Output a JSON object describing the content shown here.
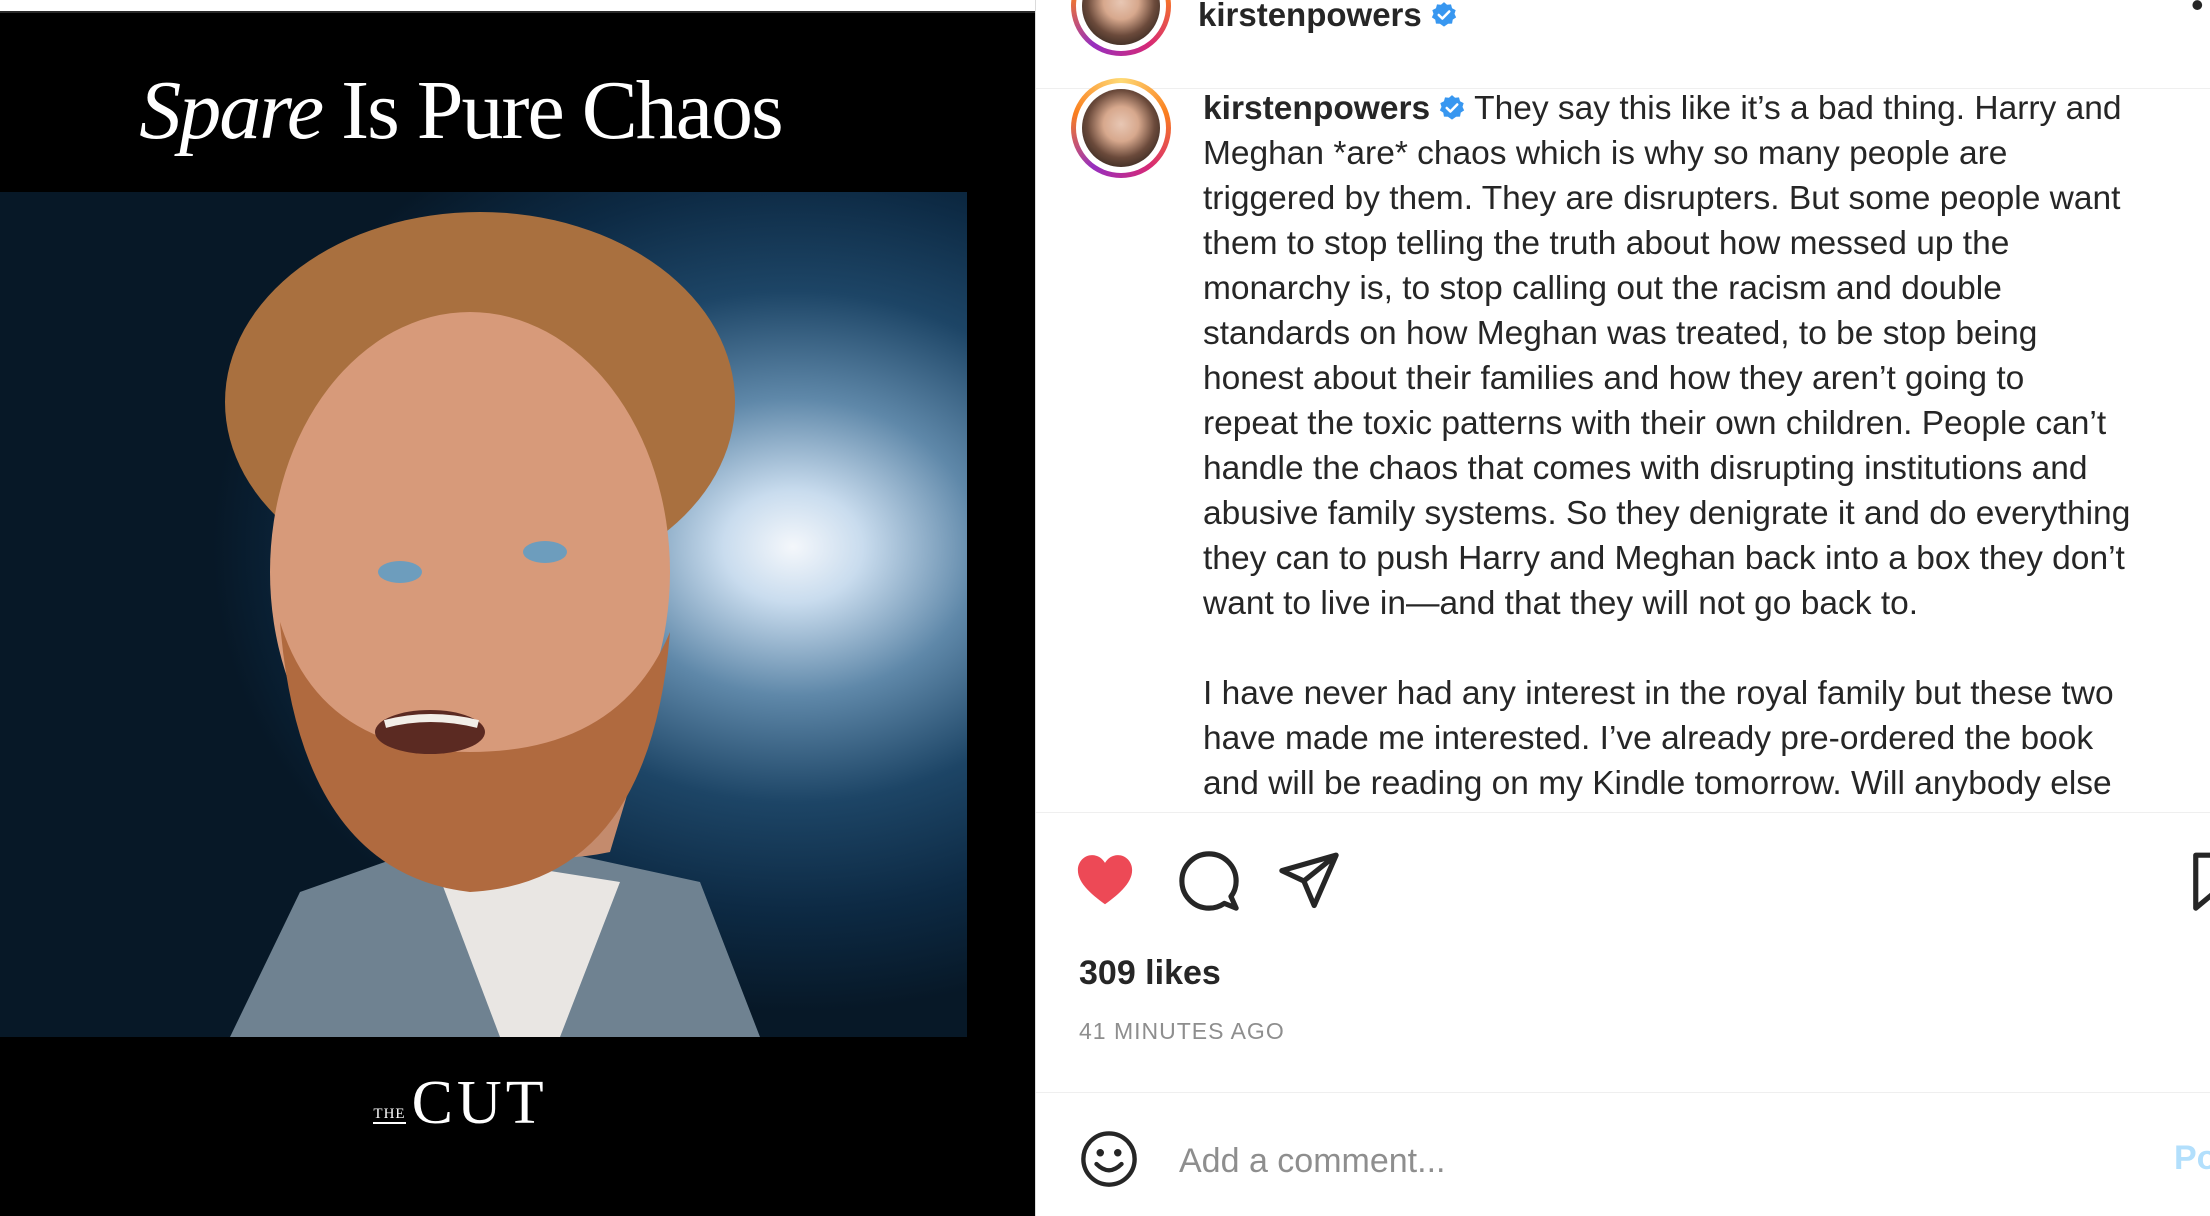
{
  "media": {
    "headline_italic": "Spare",
    "headline_rest": " Is Pure Chaos",
    "brand_small": "THE",
    "brand_large": "CUT"
  },
  "post": {
    "username": "kirstenpowers",
    "more_label": "•",
    "caption": "They say this like it’s a bad thing. Harry and\nMeghan *are* chaos which is why so many people are\ntriggered by them. They are disrupters. But some people want\nthem to stop telling the truth about how messed up the\nmonarchy is, to stop calling out the racism and double\nstandards on how Meghan was treated, to be stop being\nhonest about their families and how they aren’t going to\nrepeat the toxic patterns with their own children. People can’t\nhandle the chaos that comes with disrupting institutions and\nabusive family systems. So they denigrate it and do everything\nthey can to push Harry and Meghan back into a box they don’t\nwant to live in—and that they will not go back to.\n\nI have never had any interest in the royal family but these two\nhave made me interested. I’ve already pre-ordered the book\nand will be reading on my Kindle tomorrow. Will anybody else",
    "likes": "309 likes",
    "timestamp": "41 MINUTES AGO"
  },
  "comment": {
    "placeholder": "Add a comment...",
    "post_label": "Po"
  },
  "colors": {
    "like_red": "#ed4956",
    "verified_blue": "#3897f0",
    "post_button": "#b2dffc"
  },
  "icons": {
    "like": "heart-icon",
    "comment": "comment-bubble-icon",
    "share": "paper-plane-icon",
    "save": "bookmark-icon",
    "emoji": "smiley-icon"
  }
}
